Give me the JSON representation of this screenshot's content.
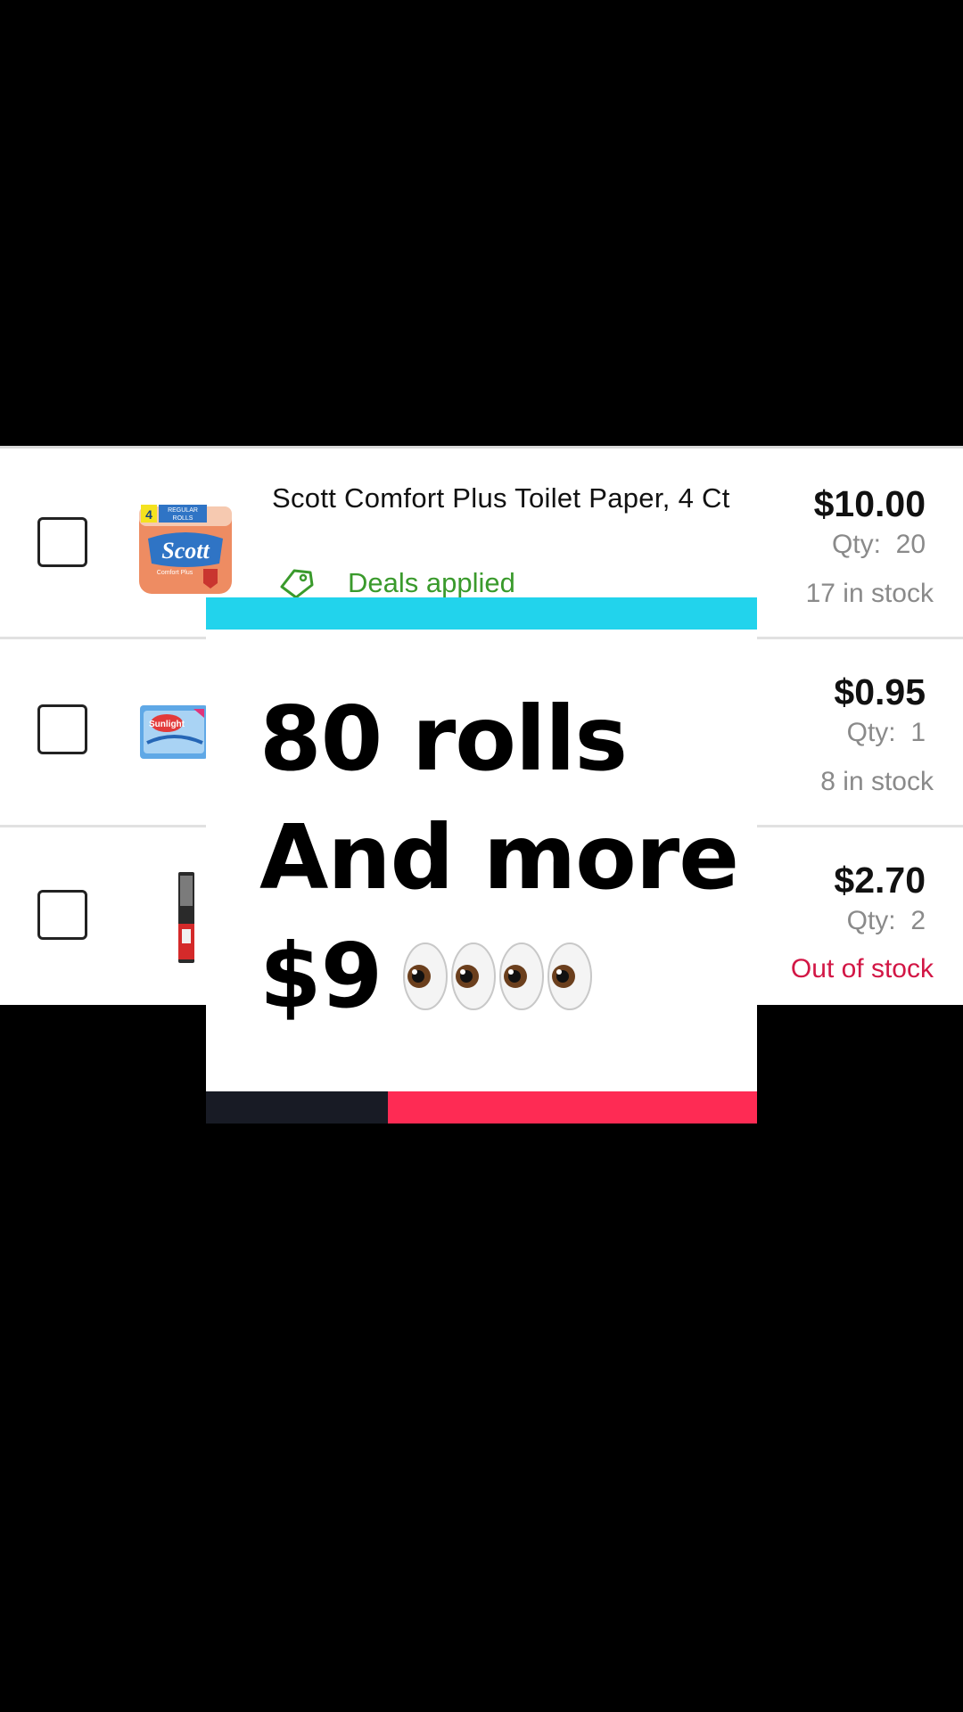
{
  "cart": {
    "items": [
      {
        "title": "Scott Comfort Plus Toilet Paper, 4 Ct",
        "deals": "Deals applied",
        "price": "$10.00",
        "qty": "Qty:  20",
        "stock": "17 in stock",
        "thumb_icon": "toilet-paper-pack-image",
        "thumb_text_count": "4",
        "thumb_text_line1": "REGULAR",
        "thumb_text_line2": "ROLLS",
        "thumb_brand": "Scott",
        "thumb_tagline": "Comfort Plus"
      },
      {
        "title": "",
        "price": "$0.95",
        "qty": "Qty:  1",
        "stock": "8 in stock",
        "thumb_icon": "sunlight-product-image",
        "thumb_brand": "Sunlight"
      },
      {
        "title": "",
        "price": "$2.70",
        "qty": "Qty:  2",
        "stock": "Out of stock",
        "stock_color": "#d21645",
        "thumb_icon": "toothbrush-image"
      }
    ]
  },
  "overlay": {
    "line1": "80 rolls",
    "line2": "And more",
    "line3": "$9",
    "emoji": [
      "eyes-emoji",
      "eyes-emoji",
      "eyes-emoji",
      "eyes-emoji"
    ],
    "accent_top": "#22d3ec",
    "accent_bottom_left": "#181b25",
    "accent_bottom_right": "#fe2b54"
  }
}
